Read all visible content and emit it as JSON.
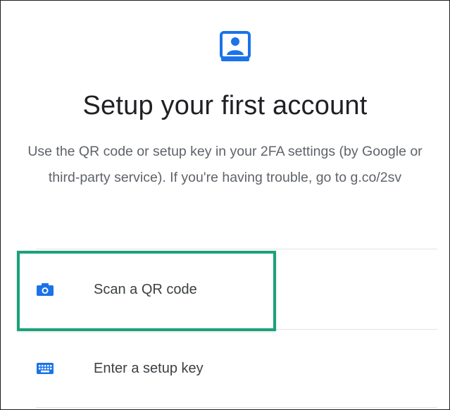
{
  "title": "Setup your first account",
  "description": "Use the QR code or setup key in your 2FA settings (by Google or third-party service). If you're having trouble, go to g.co/2sv",
  "options": [
    {
      "label": "Scan a QR code",
      "icon": "camera-icon",
      "highlighted": true
    },
    {
      "label": "Enter a setup key",
      "icon": "keyboard-icon",
      "highlighted": false
    }
  ],
  "colors": {
    "accent": "#1a73e8",
    "highlight_border": "#1ba27a",
    "title_text": "#202124",
    "body_text": "#5f6368"
  },
  "hero_icon": "account-badge-icon"
}
